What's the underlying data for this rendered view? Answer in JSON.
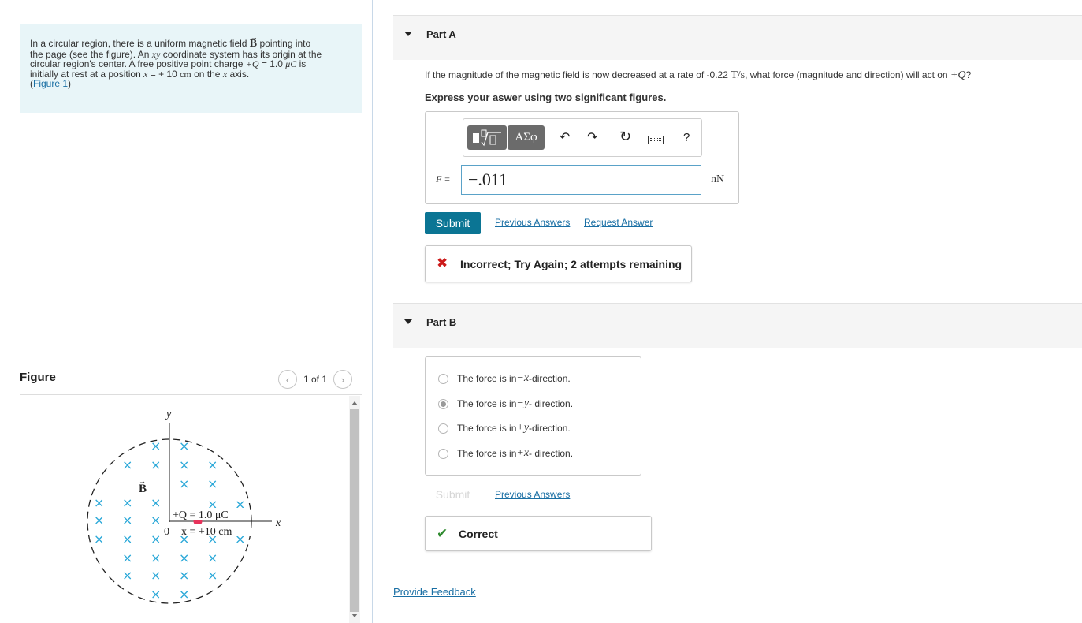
{
  "intro": {
    "line1": "In a circular region, there is a uniform magnetic field ",
    "b_symbol": "B",
    "line1b": " pointing into",
    "line2": "the page (see the figure). An ",
    "xy": "xy",
    "line2b": " coordinate system has its origin at the",
    "line3": "circular region's center. A free positive point charge ",
    "q_value": "+Q",
    "line3b": " = 1.0 ",
    "unit_uc": "μC",
    "line3c": " is",
    "line4": "initially at rest at a position ",
    "x_var": "x",
    "line4b": " = + 10 ",
    "unit_cm": "cm",
    "line4c": " on the ",
    "x_var2": "x",
    "line4d": " axis.",
    "figure_link": "Figure 1",
    "open_paren": "(",
    "close_paren": ")"
  },
  "figure": {
    "title": "Figure",
    "pager": "1 of 1",
    "prev_icon": "chevron-left-icon",
    "next_icon": "chevron-right-icon",
    "axis_y": "y",
    "axis_x": "x",
    "origin": "0",
    "field_label": "B",
    "charge_label": "+Q = 1.0 μC",
    "position_label": "x = +10 cm",
    "colors": {
      "cross": "#2aa8d8",
      "charge": "#e8335b",
      "circle": "#222222"
    }
  },
  "partA": {
    "title": "Part A",
    "question_pre": "If the magnitude of the magnetic field is now decreased at a rate of -0.22 ",
    "question_unit": "T/s",
    "question_mid": ", what force (magnitude and direction) will act on ",
    "question_q": "+Q",
    "question_end": "?",
    "instruction": "Express your aswer using two significant figures.",
    "toolbar": {
      "greek": "ΑΣφ",
      "undo_icon": "undo-icon",
      "redo_icon": "redo-icon",
      "reset_icon": "reset-icon",
      "keyboard_icon": "keyboard-icon",
      "help": "?"
    },
    "answer_label": "F =",
    "answer_value": "−.011",
    "answer_unit": "nN",
    "submit": "Submit",
    "previous_answers": "Previous Answers",
    "request_answer": "Request Answer",
    "feedback": "Incorrect; Try Again; 2 attempts remaining"
  },
  "partB": {
    "title": "Part B",
    "options": [
      {
        "pre": "The force is in ",
        "dir": "−x",
        "post": "-direction.",
        "selected": false
      },
      {
        "pre": "The force is in ",
        "dir": "−y",
        "post": "- direction.",
        "selected": true
      },
      {
        "pre": "The force is in ",
        "dir": "+y",
        "post": "-direction.",
        "selected": false
      },
      {
        "pre": "The force is in ",
        "dir": "+x",
        "post": "- direction.",
        "selected": false
      }
    ],
    "submit": "Submit",
    "previous_answers": "Previous Answers",
    "feedback": "Correct"
  },
  "provide_feedback": "Provide Feedback"
}
